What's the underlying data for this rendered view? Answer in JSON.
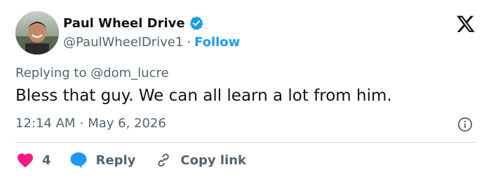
{
  "author": {
    "name": "Paul Wheel Drive",
    "handle": "@PaulWheelDrive1",
    "separator": "·",
    "follow_label": "Follow",
    "verified_icon": "verified-badge-icon",
    "avatar": "user-avatar"
  },
  "tweet": {
    "replying_to": "Replying to @dom_lucre",
    "text": "Bless that guy. We can all learn a lot from him.",
    "time": "12:14 AM",
    "date_separator": "·",
    "date": "May 6, 2026"
  },
  "actions": {
    "like_count": "4",
    "reply_label": "Reply",
    "copy_link_label": "Copy link"
  },
  "icons": {
    "platform_logo": "x-logo-icon",
    "info": "info-icon",
    "like": "heart-icon",
    "reply": "speech-bubble-icon",
    "copy": "link-icon"
  },
  "colors": {
    "accent": "#1d9bf0",
    "like": "#f91880",
    "text": "#0f1419",
    "muted": "#536471",
    "divider": "#cfd9de"
  }
}
